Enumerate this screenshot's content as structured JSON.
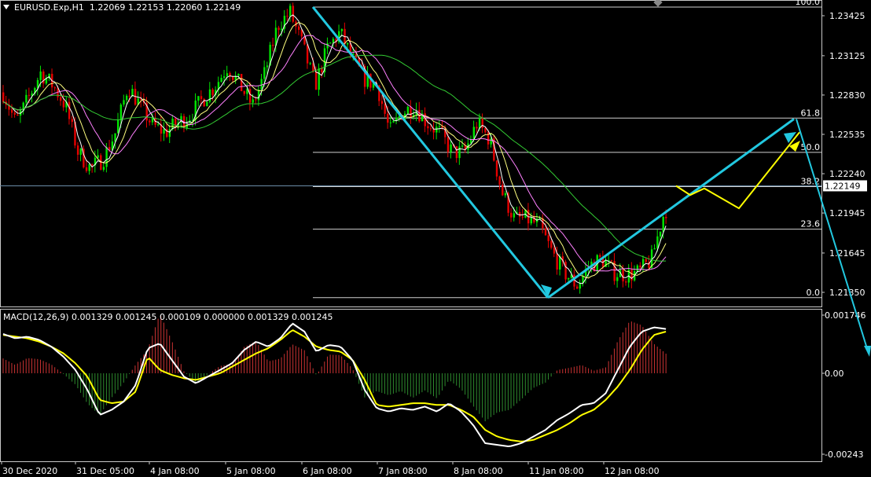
{
  "header": {
    "symbol": "EURUSD.Exp,H1",
    "ohlc": "1.22069 1.22153 1.22060 1.22149"
  },
  "colors": {
    "background": "#000000",
    "grid_frame": "#c8c8c8",
    "bull_candle": "#00e600",
    "bear_candle": "#e60000",
    "ma_fast": "#ffffff",
    "ma_mid": "#ffff80",
    "ma_slow": "#ff80ff",
    "ma_long": "#33cc33",
    "trend_arrow": "#22c8e0",
    "forecast_arrow": "#ffff00",
    "macd_line": "#ffffff",
    "signal_line": "#ffff00",
    "hist_up": "#cc3333",
    "hist_down": "#2e8b2e"
  },
  "chart_data": {
    "type": "candlestick",
    "symbol": "EURUSD.Exp",
    "timeframe": "H1",
    "price_axis_ticks": [
      "1.23425",
      "1.23125",
      "1.22830",
      "1.22535",
      "1.22240",
      "1.21945",
      "1.21645",
      "1.21350"
    ],
    "price_range": [
      1.2118,
      1.2362
    ],
    "current_price": "1.22149",
    "time_axis_labels": [
      "30 Dec 2020",
      "31 Dec 05:00",
      "4 Jan 08:00",
      "5 Jan 08:00",
      "6 Jan 08:00",
      "7 Jan 08:00",
      "8 Jan 08:00",
      "11 Jan 08:00",
      "12 Jan 08:00"
    ],
    "fibonacci": {
      "high": 1.2349,
      "low": 1.2131,
      "levels": [
        {
          "label": "100.0",
          "price": 1.2349
        },
        {
          "label": "61.8",
          "price": 1.22657
        },
        {
          "label": "50.0",
          "price": 1.224
        },
        {
          "label": "38.2",
          "price": 1.22143
        },
        {
          "label": "23.6",
          "price": 1.21824
        },
        {
          "label": "0.0",
          "price": 1.2131
        }
      ]
    },
    "candle_path_prices": [
      1.2285,
      1.2262,
      1.228,
      1.23,
      1.229,
      1.2275,
      1.224,
      1.2228,
      1.2235,
      1.2255,
      1.229,
      1.2275,
      1.226,
      1.2255,
      1.2262,
      1.2268,
      1.228,
      1.229,
      1.2305,
      1.229,
      1.2275,
      1.23,
      1.2335,
      1.2345,
      1.232,
      1.229,
      1.2318,
      1.233,
      1.231,
      1.2295,
      1.229,
      1.2255,
      1.227,
      1.2275,
      1.2262,
      1.2255,
      1.224,
      1.224,
      1.2262,
      1.225,
      1.221,
      1.219,
      1.219,
      1.2185,
      1.2165,
      1.215,
      1.214,
      1.2155,
      1.216,
      1.215,
      1.2148,
      1.215,
      1.216,
      1.2195,
      1.221,
      1.2212
    ],
    "forecast_prices": [
      1.22149,
      1.2208,
      1.2213,
      1.2198,
      1.2255
    ],
    "macd": {
      "label": "MACD(12,26,9) 0.001329 0.001245 0.000109 0.000000 0.001329 0.001245",
      "fast": 12,
      "slow": 26,
      "signal": 9,
      "axis_ticks": [
        "0.001746",
        "0.00",
        "-0.00243"
      ],
      "range": [
        -0.0025,
        0.00185
      ],
      "macd_values": [
        0.00118,
        0.00105,
        0.0011,
        0.001,
        0.0008,
        0.0005,
        0.0001,
        -0.0005,
        -0.00125,
        -0.0011,
        -0.00085,
        -0.00035,
        0.00075,
        0.0009,
        0.0004,
        -0.0001,
        -0.0003,
        -0.0001,
        0.0001,
        0.0003,
        0.0007,
        0.00095,
        0.0008,
        0.00105,
        0.0015,
        0.00125,
        0.00065,
        0.00085,
        0.0008,
        0.0004,
        -0.0005,
        -0.00105,
        -0.00115,
        -0.00105,
        -0.0011,
        -0.001,
        -0.00115,
        -0.0009,
        -0.00115,
        -0.00155,
        -0.0021,
        -0.00215,
        -0.0022,
        -0.0021,
        -0.0019,
        -0.0017,
        -0.0014,
        -0.0012,
        -0.00095,
        -0.0009,
        -0.0006,
        0.0001,
        0.0008,
        0.00125,
        0.00138,
        0.00133
      ],
      "signal_values": [
        0.00115,
        0.0011,
        0.00105,
        0.00095,
        0.0008,
        0.0006,
        0.0003,
        -0.0001,
        -0.0008,
        -0.0009,
        -0.00085,
        -0.00055,
        0.0005,
        0.0001,
        -5e-05,
        -0.00015,
        -0.0002,
        -0.0001,
        0.0,
        0.0002,
        0.0004,
        0.0006,
        0.00075,
        0.001,
        0.0013,
        0.0011,
        0.0008,
        0.0007,
        0.00065,
        0.0004,
        -0.0002,
        -0.00095,
        -0.001,
        -0.00095,
        -0.0009,
        -0.0009,
        -0.00095,
        -0.00095,
        -0.0011,
        -0.0013,
        -0.0017,
        -0.0019,
        -0.002,
        -0.00205,
        -0.002,
        -0.00185,
        -0.0017,
        -0.0015,
        -0.00125,
        -0.0011,
        -0.0008,
        -0.0004,
        0.0001,
        0.0007,
        0.00115,
        0.00125
      ]
    }
  }
}
